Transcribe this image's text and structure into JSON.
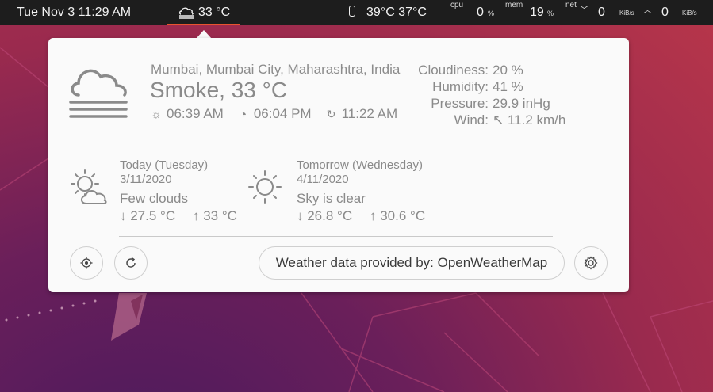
{
  "topbar": {
    "clock": "Tue Nov 3  11:29 AM",
    "weather_temp": "33 °C",
    "sensors": "39°C 37°C",
    "cpu_label": "cpu",
    "cpu_value": "0",
    "cpu_unit": "%",
    "mem_label": "mem",
    "mem_value": "19",
    "mem_unit": "%",
    "net_label": "net",
    "net_down_value": "0",
    "net_down_unit": "KiB/s",
    "net_up_value": "0",
    "net_up_unit": "KiB/s"
  },
  "current": {
    "location": "Mumbai, Mumbai City, Maharashtra, India",
    "condition": "Smoke, 33 °C",
    "sunrise": "06:39 AM",
    "sunset": "06:04 PM",
    "updated": "11:22 AM",
    "cloudiness_label": "Cloudiness:",
    "cloudiness": "20 %",
    "humidity_label": "Humidity:",
    "humidity": "41 %",
    "pressure_label": "Pressure:",
    "pressure": "29.9 inHg",
    "wind_label": "Wind:",
    "wind": "↖ 11.2 km/h"
  },
  "forecast": [
    {
      "day": "Today (Tuesday)",
      "date": "3/11/2020",
      "condition": "Few clouds",
      "low": "↓  27.5 °C",
      "high": "↑  33 °C"
    },
    {
      "day": "Tomorrow (Wednesday)",
      "date": "4/11/2020",
      "condition": "Sky is clear",
      "low": "↓  26.8 °C",
      "high": "↑  30.6 °C"
    }
  ],
  "footer": {
    "provider_label": "Weather data provided by:  OpenWeatherMap"
  },
  "colors": {
    "accent": "#e9542f",
    "topbar_bg": "#1d1d1d",
    "popup_bg": "#fafafa"
  }
}
